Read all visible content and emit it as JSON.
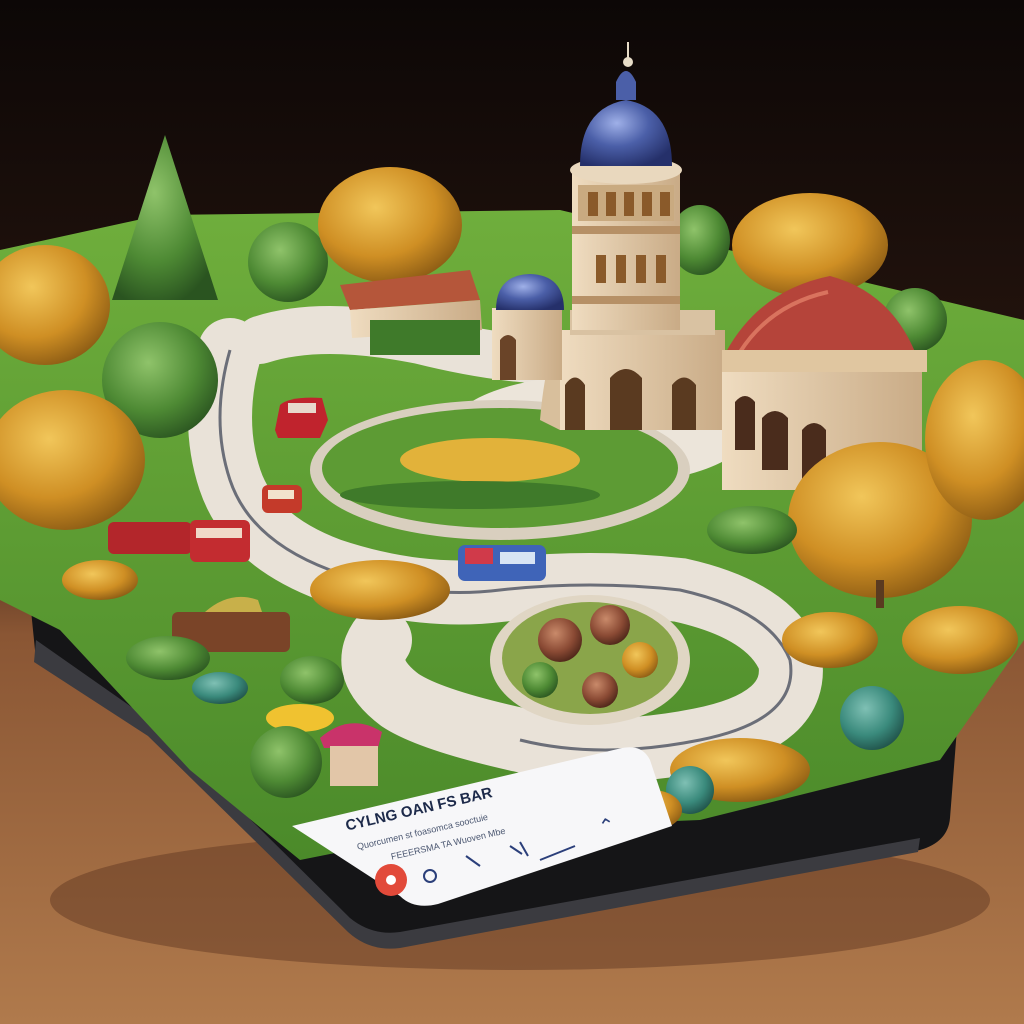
{
  "card": {
    "title": "CYLNG OAN FS BAR",
    "line_1": "Quorcumen st foasomca sooctuie",
    "line_2": "FEEERSMA TA Wuoven Mbe",
    "arrow_icon": "up-arrow-icon",
    "button_icon": "red-circle-button-icon"
  },
  "colors": {
    "background_top": "#0d0806",
    "table": "#a26a40",
    "lawn": "#5f9e32",
    "road": "#e9e2d8",
    "autumn_foliage": "#d79a2a",
    "dome": "#4b5fa8",
    "roof_red": "#b5443a",
    "card": "#f7f7f9",
    "button_red": "#e24a3a"
  }
}
